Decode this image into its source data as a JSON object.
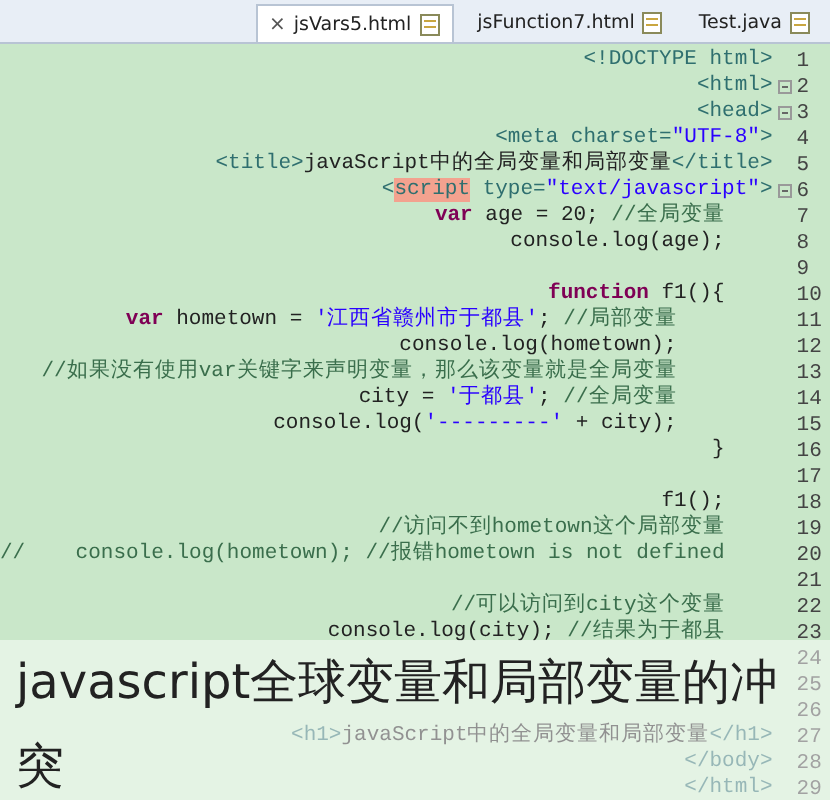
{
  "tabs": [
    {
      "label": "jsVars5.html",
      "selected": true,
      "close": "×"
    },
    {
      "label": "jsFunction7.html",
      "selected": false
    },
    {
      "label": "Test.java",
      "selected": false
    }
  ],
  "lines": [
    {
      "number": "1",
      "fold": false,
      "tokens": [
        {
          "text": "<!DOCTYPE html>",
          "kind": "tag"
        }
      ]
    },
    {
      "number": "2",
      "fold": true,
      "tokens": [
        {
          "text": "<html>",
          "kind": "tag"
        }
      ]
    },
    {
      "number": "3",
      "fold": true,
      "tokens": [
        {
          "text": "<head>",
          "kind": "tag"
        }
      ]
    },
    {
      "number": "4",
      "fold": false,
      "tokens": [
        {
          "text": "<meta charset=",
          "kind": "tag"
        },
        {
          "text": "\"UTF-8\"",
          "kind": "string"
        },
        {
          "text": ">",
          "kind": "tag"
        }
      ]
    },
    {
      "number": "5",
      "fold": false,
      "tokens": [
        {
          "text": "<title>",
          "kind": "tag"
        },
        {
          "text": "javaScript中的全局变量和局部变量",
          "kind": "plain"
        },
        {
          "text": "</title>",
          "kind": "tag"
        }
      ]
    },
    {
      "number": "6",
      "fold": true,
      "tokens": [
        {
          "text": "<",
          "kind": "tag"
        },
        {
          "text": "script",
          "kind": "highlight"
        },
        {
          "text": " type=",
          "kind": "tag"
        },
        {
          "text": "\"text/javascript\"",
          "kind": "string"
        },
        {
          "text": ">",
          "kind": "tag"
        }
      ],
      "children": [
        {
          "number": "7",
          "fold": false,
          "tokens": [
            {
              "text": "var",
              "kind": "keyword"
            },
            {
              "text": " age = 20; ",
              "kind": "plain"
            },
            {
              "text": "//全局变量",
              "kind": "comment"
            }
          ]
        },
        {
          "number": "8",
          "fold": false,
          "tokens": [
            {
              "text": "console.log(age);",
              "kind": "plain"
            }
          ]
        },
        {
          "number": "9",
          "fold": false
        },
        {
          "number": "10",
          "fold": false,
          "tokens": [
            {
              "text": "function",
              "kind": "keyword"
            },
            {
              "text": " f1(){",
              "kind": "plain"
            }
          ],
          "children": [
            {
              "number": "11",
              "fold": false,
              "tokens": [
                {
                  "text": "var",
                  "kind": "keyword"
                },
                {
                  "text": " hometown = ",
                  "kind": "plain"
                },
                {
                  "text": "'江西省赣州市于都县'",
                  "kind": "string"
                },
                {
                  "text": "; ",
                  "kind": "plain"
                },
                {
                  "text": "//局部变量",
                  "kind": "comment"
                }
              ]
            },
            {
              "number": "12",
              "fold": false,
              "tokens": [
                {
                  "text": "console.log(hometown);",
                  "kind": "plain"
                }
              ]
            },
            {
              "number": "13",
              "fold": false,
              "tokens": [
                {
                  "text": "//如果没有使用var关键字来声明变量，那么该变量就是全局变量",
                  "kind": "comment"
                }
              ]
            },
            {
              "number": "14",
              "fold": false,
              "tokens": [
                {
                  "text": "city = ",
                  "kind": "plain"
                },
                {
                  "text": "'于都县'",
                  "kind": "string"
                },
                {
                  "text": "; ",
                  "kind": "plain"
                },
                {
                  "text": "//全局变量",
                  "kind": "comment"
                }
              ]
            },
            {
              "number": "15",
              "fold": false,
              "tokens": [
                {
                  "text": "console.log(",
                  "kind": "plain"
                },
                {
                  "text": "'---------'",
                  "kind": "string"
                },
                {
                  "text": " + city);",
                  "kind": "plain"
                }
              ]
            }
          ]
        },
        {
          "number": "16",
          "fold": false,
          "tokens": [
            {
              "text": "}",
              "kind": "plain"
            }
          ]
        },
        {
          "number": "17",
          "fold": false
        },
        {
          "number": "18",
          "fold": false,
          "tokens": [
            {
              "text": "f1();",
              "kind": "plain"
            }
          ]
        },
        {
          "number": "19",
          "fold": false,
          "tokens": [
            {
              "text": "//访问不到hometown这个局部变量",
              "kind": "comment"
            }
          ]
        },
        {
          "number": "20",
          "fold": false,
          "tokens": [
            {
              "text": "//    console.log(hometown); //报错hometown is not defined",
              "kind": "comment"
            }
          ]
        },
        {
          "number": "21",
          "fold": false
        },
        {
          "number": "22",
          "fold": false,
          "tokens": [
            {
              "text": "//可以访问到city这个变量",
              "kind": "comment"
            }
          ]
        },
        {
          "number": "23",
          "fold": false,
          "tokens": [
            {
              "text": "console.log(city); ",
              "kind": "plain"
            },
            {
              "text": "//结果为于都县",
              "kind": "comment"
            }
          ]
        }
      ]
    },
    {
      "number": "24",
      "fold": false
    },
    {
      "number": "25",
      "fold": false
    },
    {
      "number": "26",
      "fold": false
    },
    {
      "number": "27",
      "fold": false,
      "tokens": [
        {
          "text": "<h1>",
          "kind": "tag"
        },
        {
          "text": "javaScript中的全局变量和局部变量",
          "kind": "plain"
        },
        {
          "text": "</h1>",
          "kind": "tag"
        }
      ]
    },
    {
      "number": "28",
      "fold": false,
      "tokens": [
        {
          "text": "</body>",
          "kind": "tag"
        }
      ]
    },
    {
      "number": "29",
      "fold": false,
      "tokens": [
        {
          "text": "</html>",
          "kind": "tag"
        }
      ]
    }
  ],
  "caption": "javascript全球变量和局部变量的冲突"
}
